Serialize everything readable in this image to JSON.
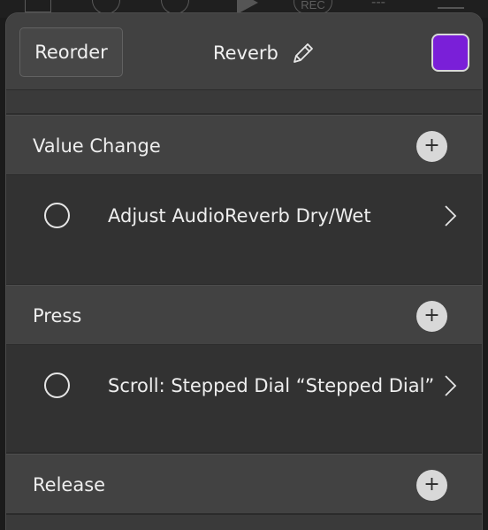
{
  "backdrop": {
    "rec_label": "REC",
    "counter": "---"
  },
  "header": {
    "reorder_label": "Reorder",
    "title": "Reverb",
    "color": "#7a1fd8"
  },
  "sections": [
    {
      "title": "Value Change",
      "add_symbol": "+",
      "actions": [
        {
          "label": "Adjust AudioReverb Dry/Wet"
        }
      ]
    },
    {
      "title": "Press",
      "add_symbol": "+",
      "actions": [
        {
          "label": "Scroll: Stepped Dial “Stepped Dial”"
        }
      ]
    },
    {
      "title": "Release",
      "add_symbol": "+",
      "actions": []
    }
  ]
}
